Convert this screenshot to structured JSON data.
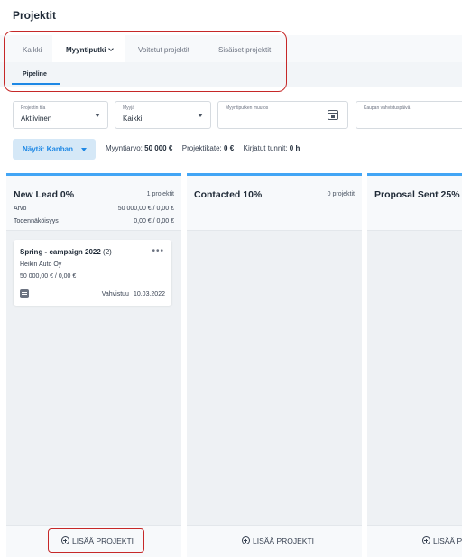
{
  "page": {
    "title": "Projektit"
  },
  "tabs": {
    "items": [
      {
        "label": "Kaikki"
      },
      {
        "label": "Myyntiputki"
      },
      {
        "label": "Voitetut projektit"
      },
      {
        "label": "Sisäiset projektit"
      }
    ],
    "sub": "Pipeline"
  },
  "filters": {
    "status": {
      "label": "Projektin tila",
      "value": "Aktiivinen"
    },
    "seller": {
      "label": "Myyjä",
      "value": "Kaikki"
    },
    "pipeline_change": {
      "label": "Myyntiputken muutos",
      "value": ""
    },
    "deal_date": {
      "label": "Kaupan vahvistuspäivä",
      "value": ""
    }
  },
  "view": {
    "label": "Näytä: Kanban"
  },
  "summary": {
    "sales_label": "Myyntiarvo:",
    "sales_value": "50 000 €",
    "margin_label": "Projektikate:",
    "margin_value": "0 €",
    "hours_label": "Kirjatut tunnit:",
    "hours_value": "0 h"
  },
  "columns": [
    {
      "name": "New Lead 0%",
      "count": "1 projektit",
      "value_label": "Arvo",
      "value": "50 000,00 € / 0,00 €",
      "prob_label": "Todennäköisyys",
      "prob": "0,00 € / 0,00 €",
      "add_label": "LISÄÄ PROJEKTI"
    },
    {
      "name": "Contacted 10%",
      "count": "0 projektit",
      "add_label": "LISÄÄ PROJEKTI"
    },
    {
      "name": "Proposal Sent 25%",
      "count": "",
      "add_label": "LISÄÄ P"
    }
  ],
  "card": {
    "title": "Spring - campaign 2022",
    "count": "(2)",
    "company": "Heikin Auto Oy",
    "amount": "50 000,00 € / 0,00 €",
    "confirm_label": "Vahvistuu",
    "confirm_date": "10.03.2022"
  },
  "colors": {
    "accent": "#1e88e5",
    "highlight": "#c62828",
    "column_top": "#42a5f5"
  }
}
